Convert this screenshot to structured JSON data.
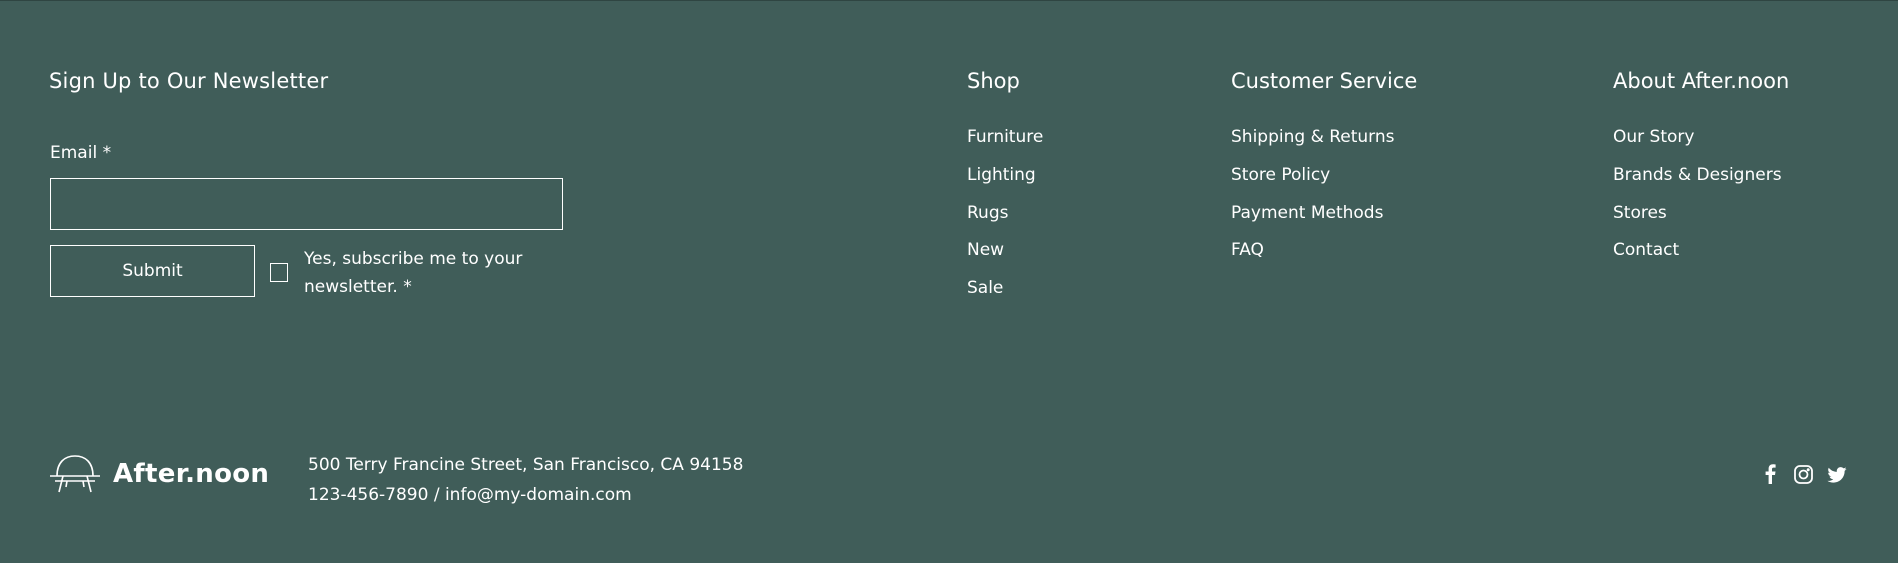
{
  "newsletter": {
    "title": "Sign Up to Our Newsletter",
    "email_label": "Email *",
    "email_value": "",
    "submit_label": "Submit",
    "subscribe_label": "Yes, subscribe me to your newsletter. *",
    "subscribe_checked": false
  },
  "shop": {
    "title": "Shop",
    "links": [
      "Furniture",
      "Lighting",
      "Rugs",
      "New",
      "Sale"
    ]
  },
  "customer_service": {
    "title": "Customer Service",
    "links": [
      "Shipping & Returns",
      "Store Policy",
      "Payment Methods",
      "FAQ"
    ]
  },
  "about": {
    "title": "About After.noon",
    "links": [
      "Our Story",
      "Brands & Designers",
      "Stores",
      "Contact"
    ]
  },
  "brand": {
    "name": "After.noon",
    "logo_icon": "chair-icon"
  },
  "contact": {
    "address": "500 Terry Francine Street, San Francisco, CA 94158",
    "phone_email": "123-456-7890 / info@my-domain.com"
  },
  "social": {
    "icons": [
      "facebook-icon",
      "instagram-icon",
      "twitter-icon"
    ]
  },
  "colors": {
    "background": "#405d59",
    "text": "#ffffff"
  }
}
